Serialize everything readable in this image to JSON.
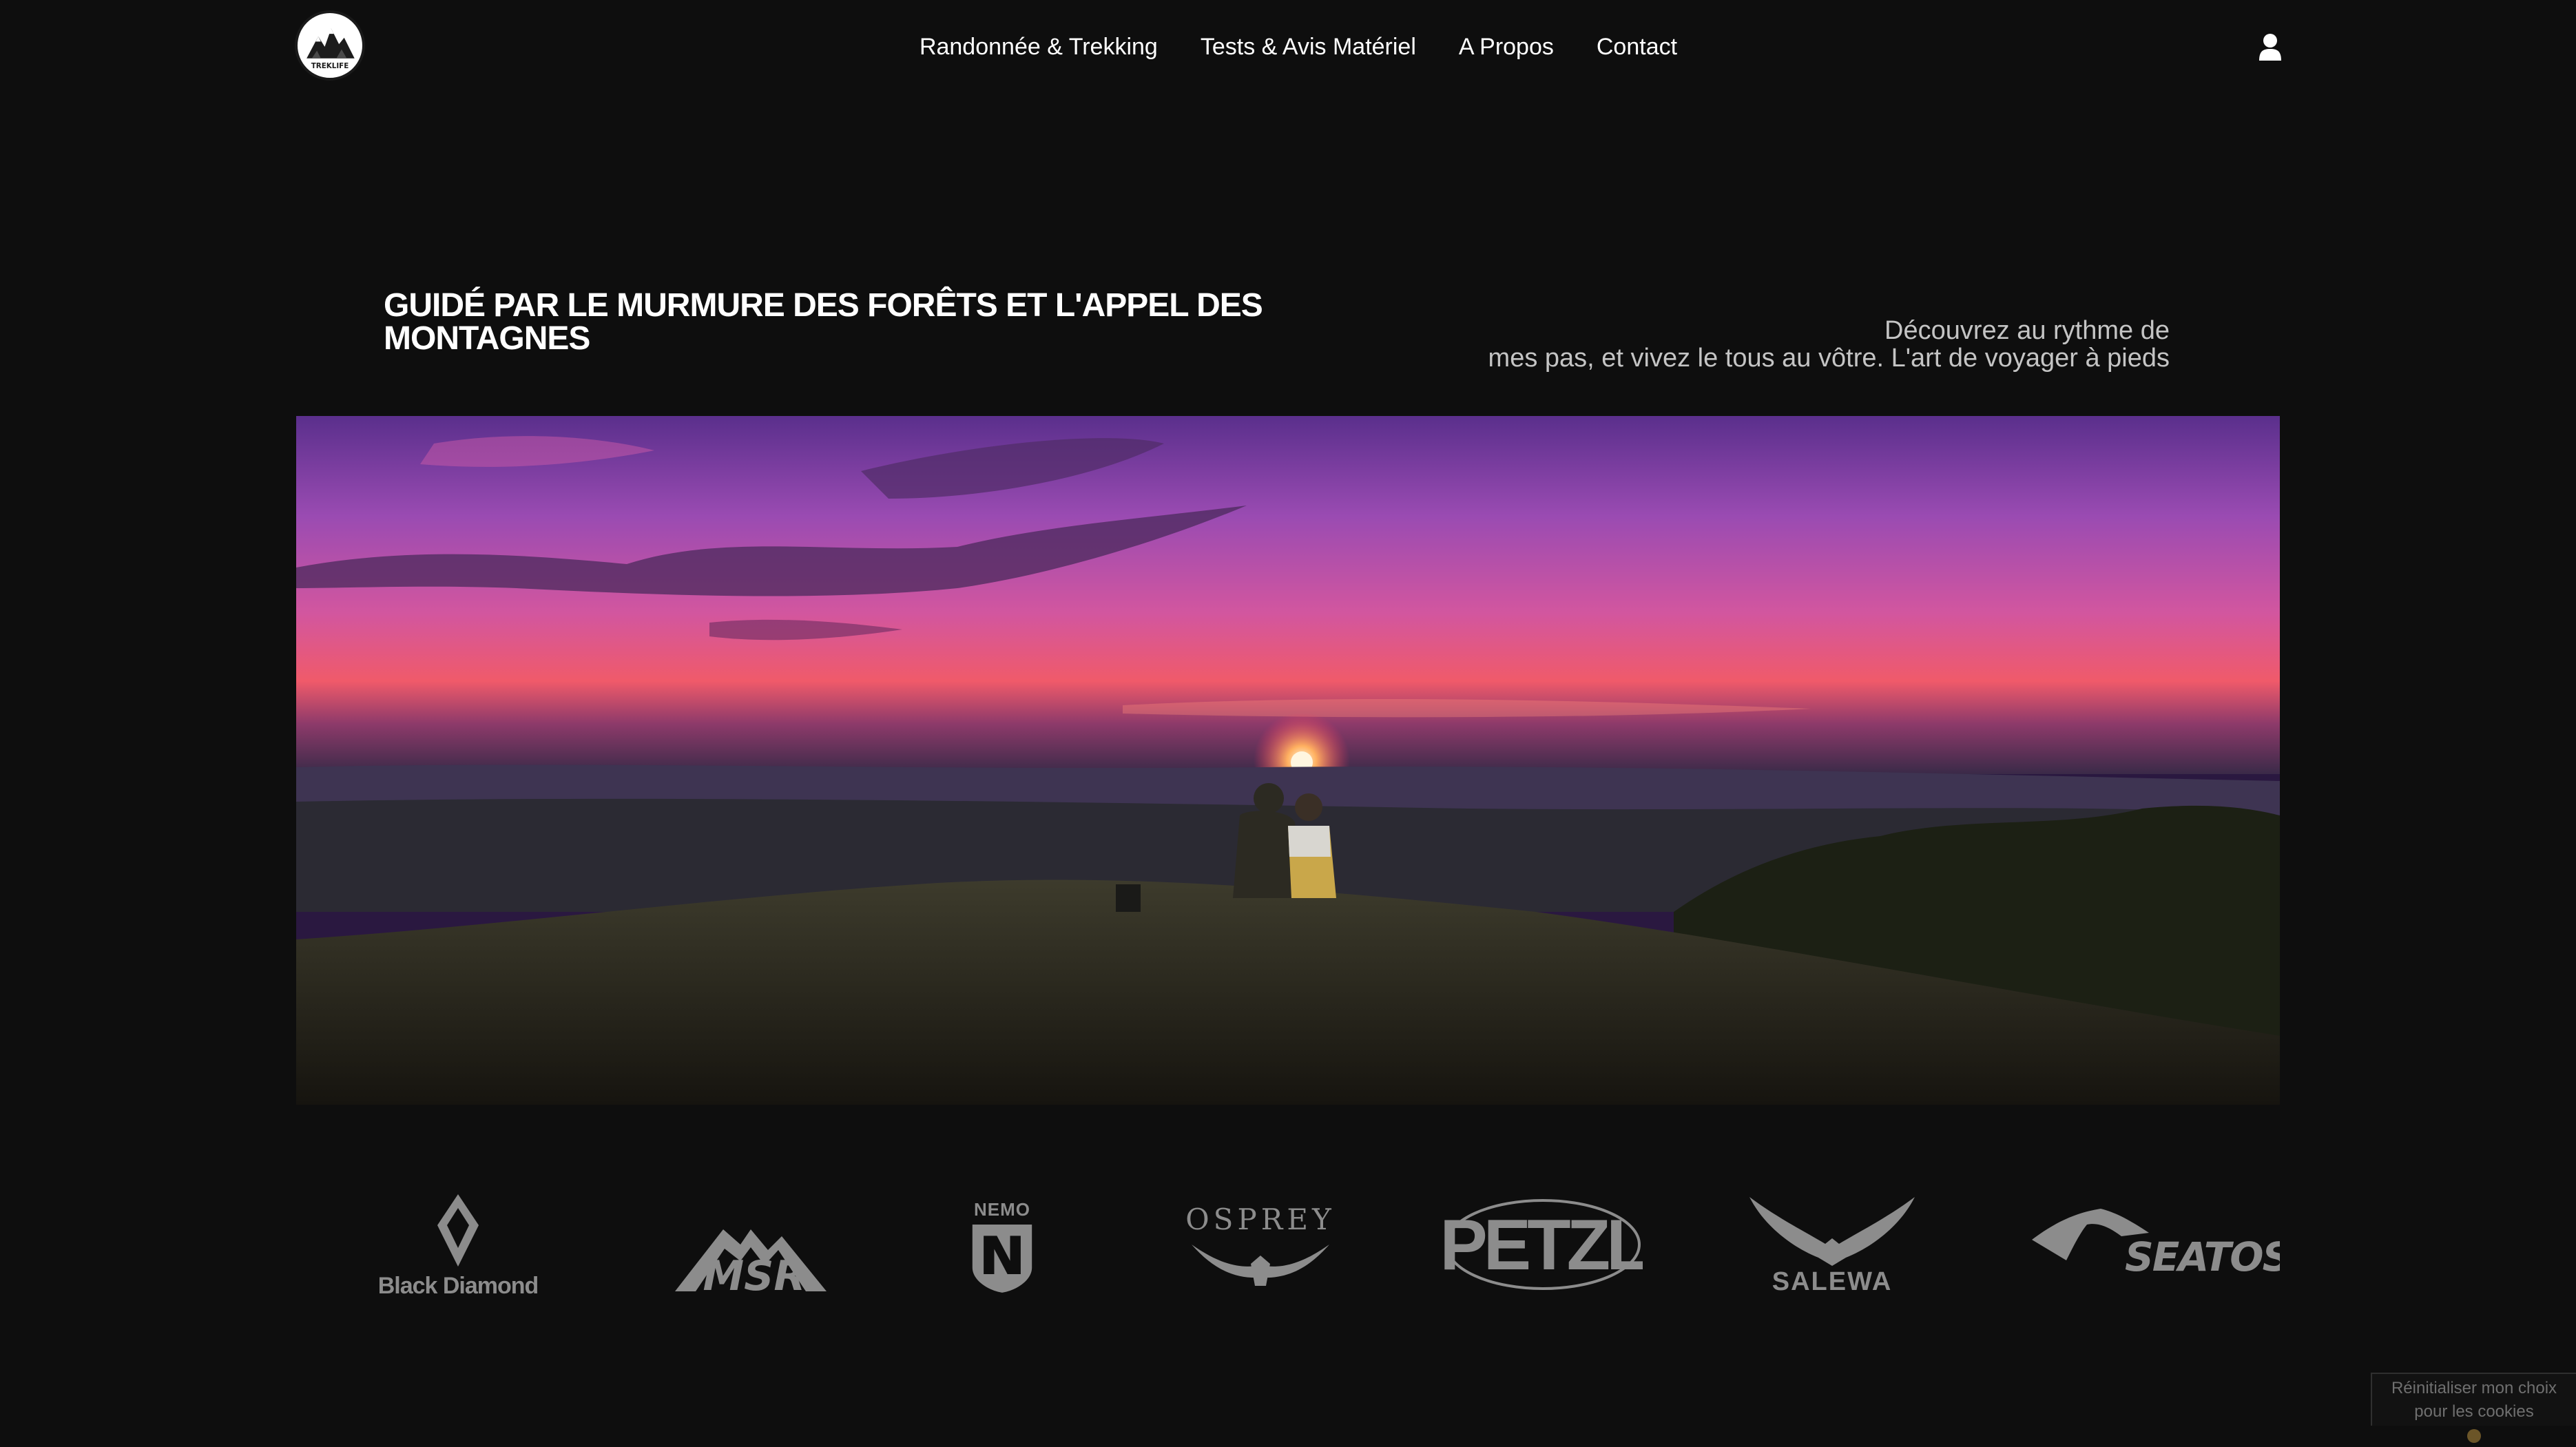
{
  "header": {
    "logo_text": "TREKLIFE",
    "nav": [
      {
        "label": "Randonnée & Trekking"
      },
      {
        "label": "Tests & Avis Matériel"
      },
      {
        "label": "A Propos"
      },
      {
        "label": "Contact"
      }
    ],
    "account_icon": "user-icon"
  },
  "hero": {
    "title": "GUIDÉ PAR LE MURMURE DES FORÊTS ET L'APPEL DES MONTAGNES",
    "subtitle_line1": "Découvrez au rythme de",
    "subtitle_line2": "mes pas, et vivez le tous au vôtre. L'art de voyager à pieds"
  },
  "brands": [
    {
      "name": "Black Diamond"
    },
    {
      "name": "MSR"
    },
    {
      "name": "NEMO"
    },
    {
      "name": "OSPREY"
    },
    {
      "name": "PETZL"
    },
    {
      "name": "SALEWA"
    },
    {
      "name": "SEATOSUMMIT"
    }
  ],
  "cookie_button": {
    "line1": "Réinitialiser mon choix",
    "line2": "pour les cookies",
    "icon": "cookie-icon"
  },
  "colors": {
    "background": "#0e0e0e",
    "text": "#ffffff",
    "subtitle": "#c4c4c4",
    "brand_logo": "#8c8c8c"
  }
}
